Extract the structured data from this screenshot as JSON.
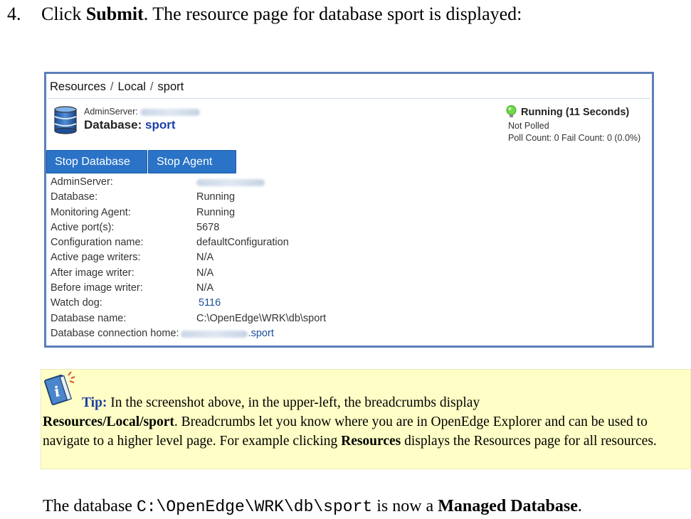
{
  "step": {
    "number": "4.",
    "pre": "Click ",
    "button": "Submit",
    "post": ".  The resource page for database sport is displayed:"
  },
  "screenshot": {
    "breadcrumbs": [
      "Resources",
      "Local",
      "sport"
    ],
    "breadcrumb_separator": "/",
    "header": {
      "admin_label": "AdminServer:",
      "db_label": "Database:",
      "db_name": "sport"
    },
    "status": {
      "state": "Running (11 Seconds)",
      "poll": "Not Polled",
      "counts": "Poll Count: 0  Fail Count: 0 (0.0%)"
    },
    "buttons": {
      "stop_database": "Stop Database",
      "stop_agent": "Stop Agent"
    },
    "properties": [
      {
        "label": "AdminServer:",
        "value": ""
      },
      {
        "label": "Database:",
        "value": "Running"
      },
      {
        "label": "Monitoring Agent:",
        "value": "Running"
      },
      {
        "label": "Active port(s):",
        "value": "5678"
      },
      {
        "label": "Configuration name:",
        "value": "defaultConfiguration"
      },
      {
        "label": "Active page writers:",
        "value": "N/A"
      },
      {
        "label": "After image writer:",
        "value": "N/A"
      },
      {
        "label": "Before image writer:",
        "value": "N/A"
      },
      {
        "label": "Watch dog:",
        "value": "5116"
      },
      {
        "label": "Database name:",
        "value": "C:\\OpenEdge\\WRK\\db\\sport"
      },
      {
        "label": "Database connection home:",
        "value": ".sport"
      }
    ],
    "colors": {
      "frame": "#5b7fb8",
      "button": "#2a73c7",
      "link": "#1a4f9a",
      "status_light": "#6fd84a"
    }
  },
  "tip": {
    "label": "Tip:",
    "line1": " In the screenshot above, in the upper-left, the breadcrumbs display",
    "path_bold": "Resources/Local/sport",
    "line2": ".   Breadcrumbs let you know where you are in OpenEdge Explorer and can be used to navigate to a higher level page.  For example clicking ",
    "resources_bold": "Resources",
    "line3": " displays the Resources page for all resources.",
    "background": "#fefec6"
  },
  "final": {
    "pre": "The database ",
    "path": "C:\\OpenEdge\\WRK\\db\\sport",
    "mid": " is now a ",
    "bold": "Managed Database",
    "post": "."
  }
}
